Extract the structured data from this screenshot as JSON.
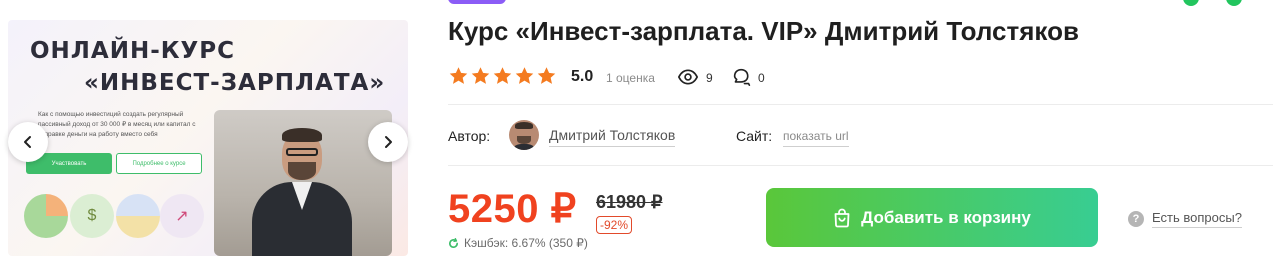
{
  "product": {
    "title": "Курс «Инвест-зарплата. VIP» Дмитрий Толстяков"
  },
  "gallery": {
    "promo_heading_line1": "ОНЛАЙН-КУРС",
    "promo_heading_line2": "«ИНВЕСТ-ЗАРПЛАТА»",
    "promo_description": "Как с помощью инвестиций создать регулярный пассивный доход от 30 000 ₽ в месяц или капитал с отправке деньги на работу вместо себя",
    "promo_button_primary": "Участвовать",
    "promo_button_secondary": "Подробнее о курсе",
    "prev_icon": "chevron-left-icon",
    "next_icon": "chevron-right-icon"
  },
  "rating": {
    "value": "5.0",
    "count_text": "1 оценка",
    "stars": 5,
    "star_color": "#f47b20"
  },
  "stats": {
    "views": "9",
    "comments": "0"
  },
  "author": {
    "label": "Автор:",
    "name": "Дмитрий Толстяков"
  },
  "site": {
    "label": "Сайт:",
    "link_text": "показать url"
  },
  "price": {
    "current": "5250 ₽",
    "old": "61980 ₽",
    "discount": "-92%",
    "cashback": "Кэшбэк: 6.67% (350 ₽)",
    "color": "#f0421f"
  },
  "actions": {
    "add_to_cart": "Добавить в корзину",
    "questions": "Есть вопросы?",
    "cart_gradient_start": "#5ac73a",
    "cart_gradient_end": "#38cd92"
  }
}
